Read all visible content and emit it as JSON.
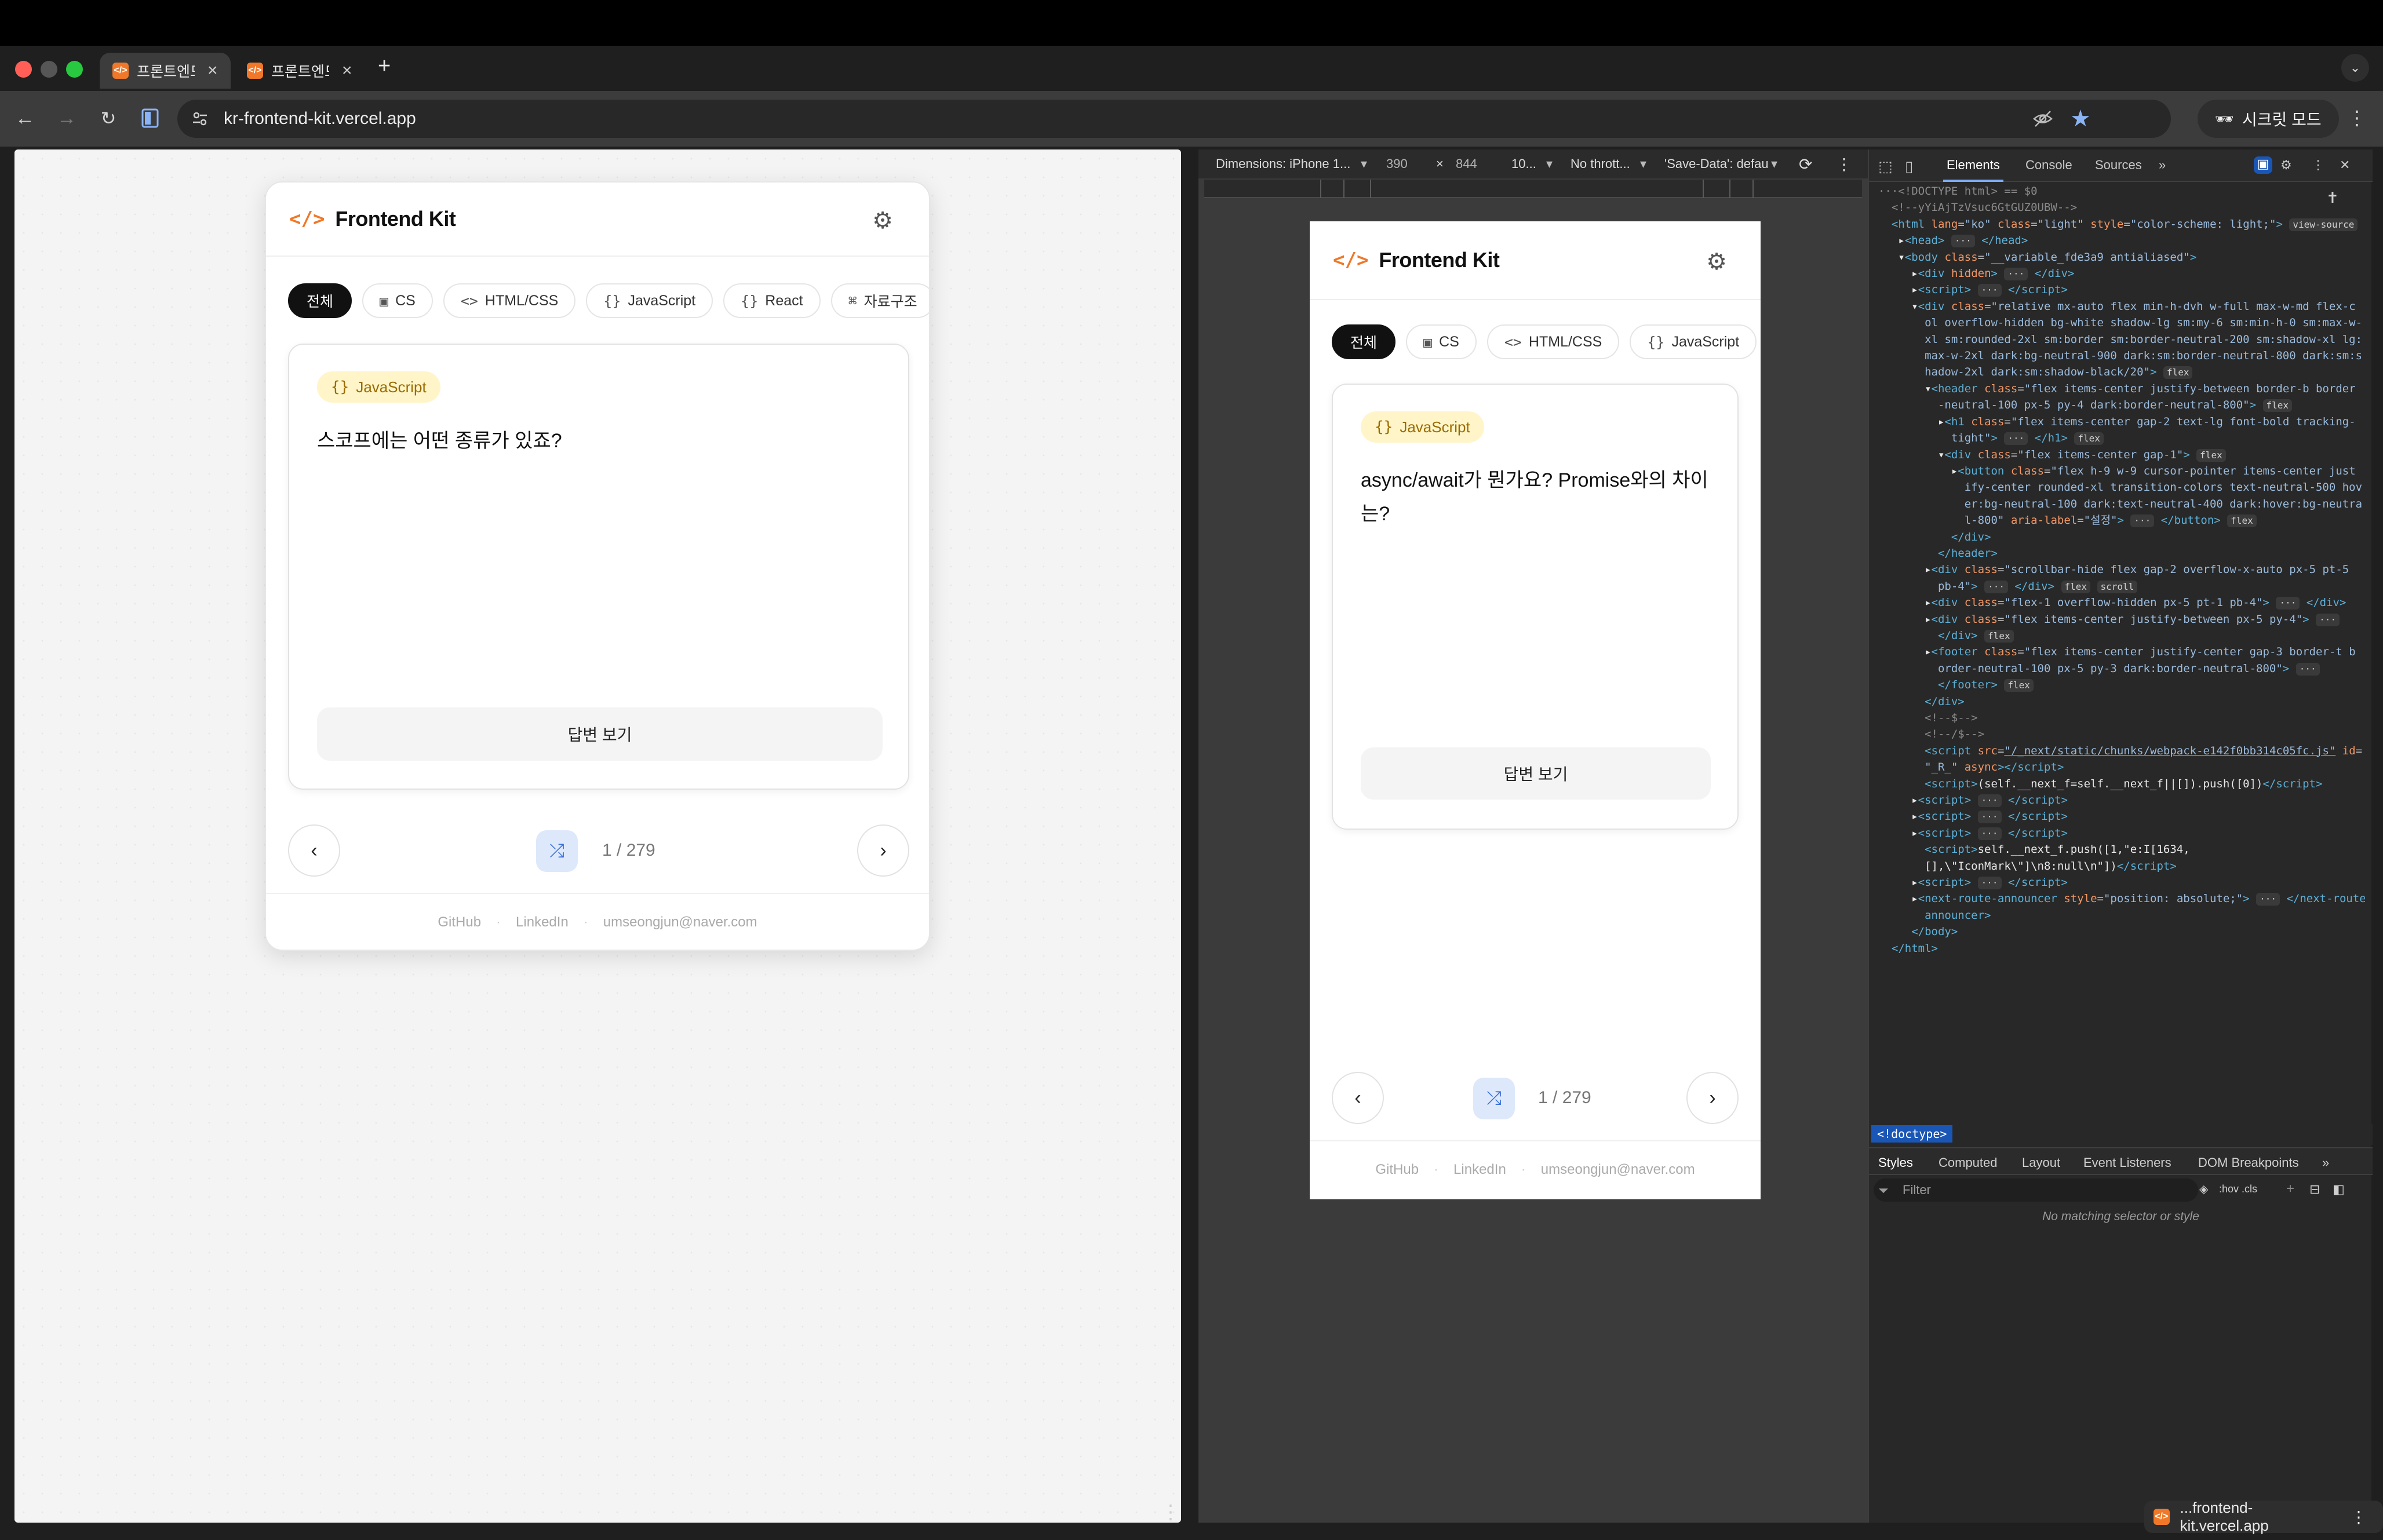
{
  "browser": {
    "tabs": [
      {
        "title": "프론트엔드 면접",
        "favicon": "</>",
        "active": true
      },
      {
        "title": "프론트엔드 면접",
        "favicon": "</>",
        "active": false
      }
    ],
    "url": "kr-frontend-kit.vercel.app",
    "incognito_label": "시크릿 모드",
    "new_tab_symbol": "+"
  },
  "app_left": {
    "brand": "Frontend Kit",
    "logo": "</>",
    "categories": [
      {
        "label": "전체",
        "icon": "",
        "selected": true
      },
      {
        "label": "CS",
        "icon": "cpu-icon"
      },
      {
        "label": "HTML/CSS",
        "icon": "code-icon"
      },
      {
        "label": "JavaScript",
        "icon": "braces-icon"
      },
      {
        "label": "React",
        "icon": "braces-icon"
      },
      {
        "label": "자료구조",
        "icon": "tree-icon"
      }
    ],
    "question": {
      "tag": "JavaScript",
      "text": "스코프에는 어떤 종류가 있죠?"
    },
    "answer_button": "답변 보기",
    "counter": "1 / 279",
    "footer": {
      "github": "GitHub",
      "linkedin": "LinkedIn",
      "email": "umseongjun@naver.com"
    }
  },
  "app_right": {
    "brand": "Frontend Kit",
    "logo": "</>",
    "categories": [
      {
        "label": "전체",
        "selected": true
      },
      {
        "label": "CS"
      },
      {
        "label": "HTML/CSS"
      },
      {
        "label": "JavaScript"
      }
    ],
    "question": {
      "tag": "JavaScript",
      "text": "async/await가 뭔가요? Promise와의 차이는?"
    },
    "answer_button": "답변 보기",
    "counter": "1 / 279",
    "footer": {
      "github": "GitHub",
      "linkedin": "LinkedIn",
      "email": "umseongjun@naver.com"
    }
  },
  "device_toolbar": {
    "dimensions": "Dimensions: iPhone 1...",
    "width": "390",
    "times": "×",
    "height": "844",
    "zoom": "10...",
    "throttle": "No thrott...",
    "save_data": "'Save-Data': defau"
  },
  "devtools": {
    "tabs": [
      "Elements",
      "Console",
      "Sources"
    ],
    "active_tab": "Elements",
    "selected_node": "<!doctype>",
    "styles_tabs": [
      "Styles",
      "Computed",
      "Layout",
      "Event Listeners",
      "DOM Breakpoints"
    ],
    "filter_placeholder": "Filter",
    "filter_tools": ":hov .cls",
    "no_match": "No matching selector or style",
    "status_pill": "...frontend-kit.vercel.app"
  },
  "colors": {
    "accent": "#f07828",
    "tag_bg": "#fff5c8",
    "shuffle_bg": "#dde8fb",
    "devtools_blue": "#7cacf8"
  }
}
